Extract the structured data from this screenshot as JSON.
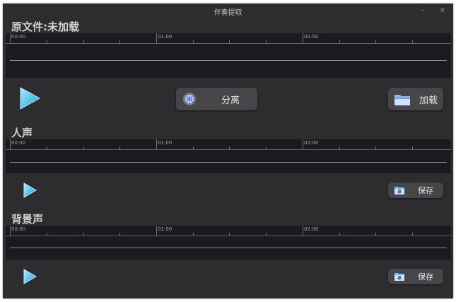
{
  "window": {
    "title": "伴奏提取"
  },
  "titlebar": {
    "minimize_glyph": "–",
    "close_glyph": "×"
  },
  "original": {
    "label": "原文件:未加载",
    "ruler": [
      "00:00",
      "01:00",
      "02:00"
    ],
    "split_button": "分离",
    "load_button": "加载"
  },
  "vocals": {
    "label": "人声",
    "ruler": [
      "00:00",
      "01:00",
      "02:00"
    ],
    "save_button": "保存"
  },
  "background": {
    "label": "背景声",
    "ruler": [
      "00:00",
      "01:00",
      "02:00"
    ],
    "save_button": "保存"
  },
  "colors": {
    "window_bg": "#2d2d30",
    "timeline_bg": "#1b1a1f",
    "play_icon": "#5ec8ea",
    "button_bg": "#464649"
  },
  "icons": {
    "play": "play-icon",
    "split": "burst-icon",
    "load": "folder-icon",
    "save": "folder-save-icon"
  }
}
